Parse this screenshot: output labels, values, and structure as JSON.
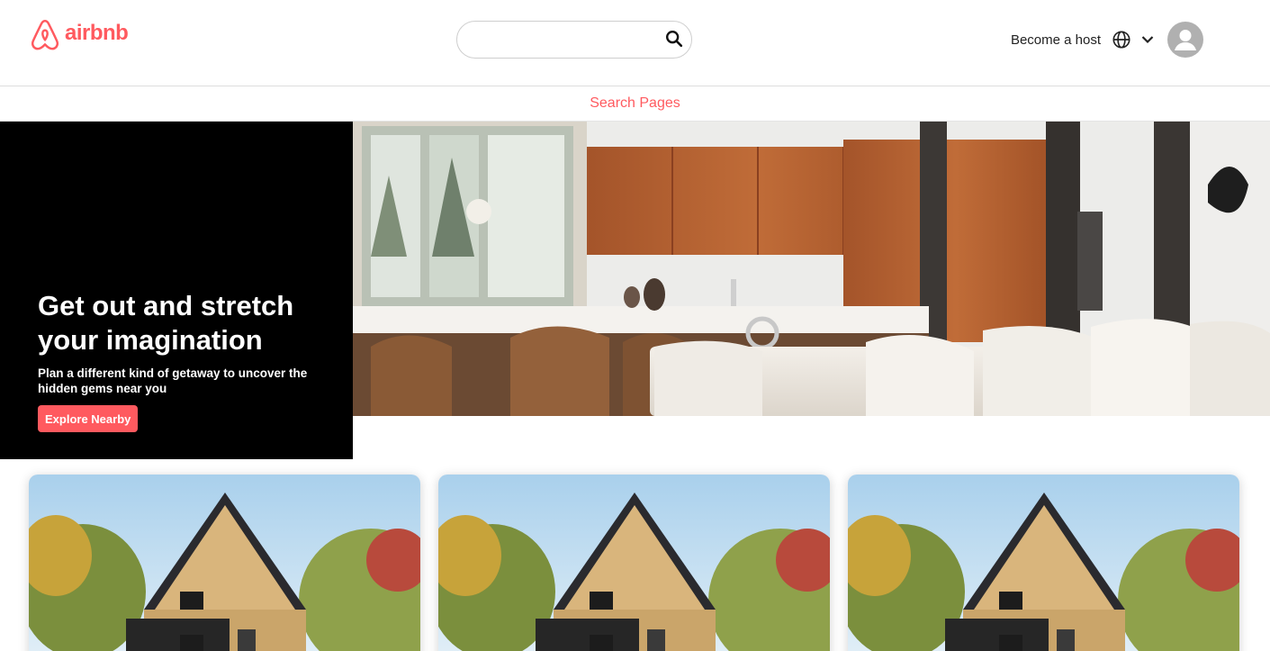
{
  "app": {
    "brand": "airbnb"
  },
  "colors": {
    "brand": "#FF5A5F",
    "black": "#000000",
    "text": "#222222"
  },
  "header": {
    "search": {
      "value": "",
      "placeholder": ""
    },
    "become_host": "Become a host",
    "icons": {
      "search": "search-icon",
      "globe": "globe-icon",
      "chevron": "chevron-down-icon",
      "avatar": "user-avatar-icon"
    }
  },
  "subnav": {
    "label": "Search Pages"
  },
  "hero": {
    "title": "Get out and stretch your imagination",
    "subtitle": "Plan a different kind of getaway to uncover the hidden gems near you",
    "button_label": "Explore Nearby"
  },
  "cards": [
    {
      "image": "a-frame cabin in autumn forest"
    },
    {
      "image": "a-frame cabin in autumn forest"
    },
    {
      "image": "a-frame cabin in autumn forest"
    }
  ]
}
